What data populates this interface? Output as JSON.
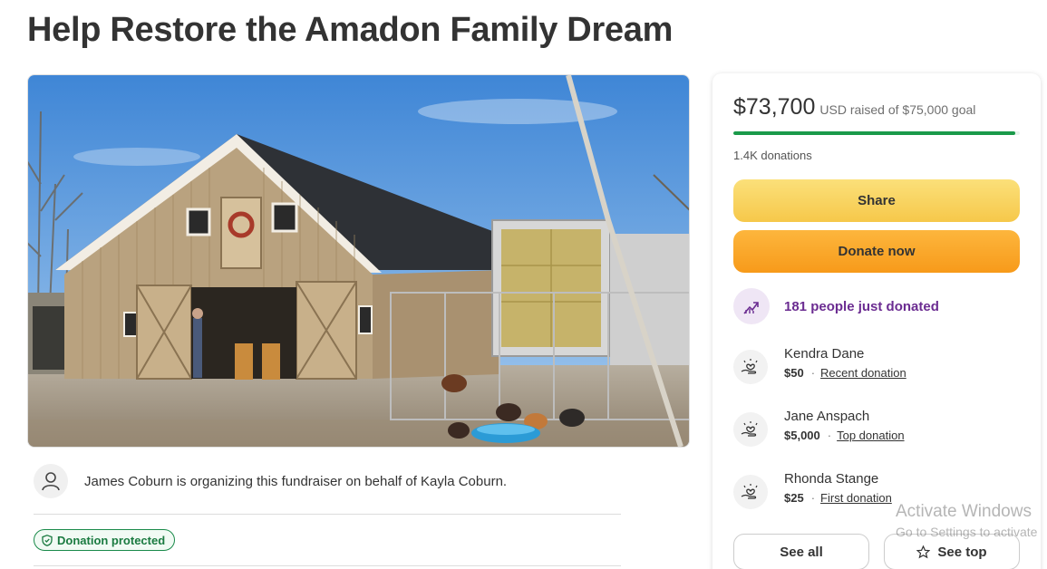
{
  "page": {
    "title": "Help Restore the Amadon Family Dream"
  },
  "hero": {
    "image": "red-barn-with-hay-trailer-and-chickens"
  },
  "organizer": {
    "text": "James Coburn is organizing this fundraiser on behalf of Kayla Coburn."
  },
  "badge": {
    "label": "Donation protected"
  },
  "donation_card": {
    "raised_amount": "$73,700",
    "goal_text": "USD raised of $75,000 goal",
    "progress_fraction": 0.9827,
    "donations_count": "1.4K donations",
    "share_label": "Share",
    "donate_label": "Donate now",
    "trend_text": "181 people just donated",
    "donors": [
      {
        "name": "Kendra Dane",
        "amount": "$50",
        "tag": "Recent donation"
      },
      {
        "name": "Jane Anspach",
        "amount": "$5,000",
        "tag": "Top donation"
      },
      {
        "name": "Rhonda Stange",
        "amount": "$25",
        "tag": "First donation"
      }
    ],
    "see_all_label": "See all",
    "see_top_label": "See top"
  },
  "watermark": {
    "line1": "Activate Windows",
    "line2": "Go to Settings to activate"
  },
  "colors": {
    "brand_green": "#1a9a4a",
    "share_yellow": "#f6c84a",
    "donate_orange": "#f79a1a",
    "trend_purple": "#6b2c91"
  }
}
